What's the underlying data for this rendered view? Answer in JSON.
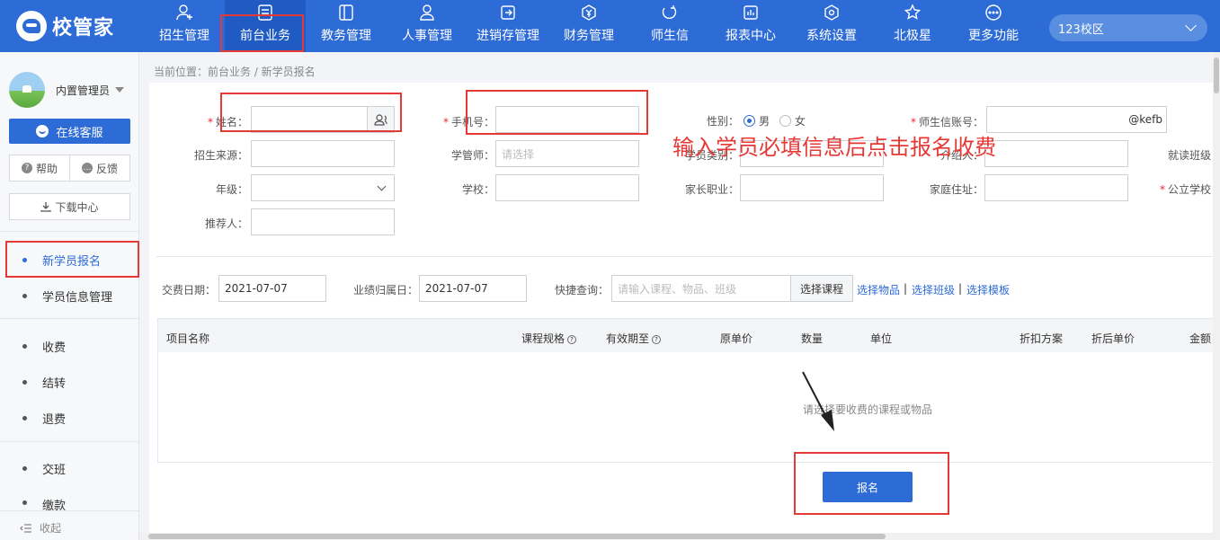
{
  "app": {
    "logo_text": "校管家"
  },
  "nav": {
    "items": [
      {
        "label": "招生管理",
        "icon": "user-plus-icon"
      },
      {
        "label": "前台业务",
        "icon": "reception-icon"
      },
      {
        "label": "教务管理",
        "icon": "book-icon"
      },
      {
        "label": "人事管理",
        "icon": "person-icon"
      },
      {
        "label": "进销存管理",
        "icon": "inventory-icon"
      },
      {
        "label": "财务管理",
        "icon": "yen-icon"
      },
      {
        "label": "师生信",
        "icon": "chat-icon"
      },
      {
        "label": "报表中心",
        "icon": "report-icon"
      },
      {
        "label": "系统设置",
        "icon": "gear-icon"
      },
      {
        "label": "北极星",
        "icon": "star-icon"
      },
      {
        "label": "更多功能",
        "icon": "more-icon"
      }
    ],
    "active_index": 1
  },
  "campus": {
    "label": "123校区"
  },
  "sidebar": {
    "user_name": "内置管理员",
    "service_label": "在线客服",
    "help_label": "帮助",
    "feedback_label": "反馈",
    "download_label": "下载中心",
    "menu": [
      "新学员报名",
      "学员信息管理",
      "收费",
      "结转",
      "退费",
      "交班",
      "缴款"
    ],
    "collapse_label": "收起"
  },
  "breadcrumb": "当前位置：前台业务 / 新学员报名",
  "form": {
    "name_label": "姓名：",
    "phone_label": "手机号：",
    "gender_label": "性别：",
    "gender_male": "男",
    "gender_female": "女",
    "account_label": "师生信账号：",
    "account_suffix": "@kefb",
    "source_label": "招生来源：",
    "advisor_label": "学管师：",
    "advisor_placeholder": "请选择",
    "type_label": "学员类别：",
    "referrer_label": "介绍人：",
    "class_label": "就读班级：",
    "grade_label": "年级：",
    "school_label": "学校：",
    "parent_job_label": "家长职业：",
    "address_label": "家庭住址：",
    "public_school_label": "公立学校：",
    "recommender_label": "推荐人："
  },
  "payment": {
    "pay_date_label": "交费日期：",
    "pay_date": "2021-07-07",
    "perf_date_label": "业绩归属日：",
    "perf_date": "2021-07-07",
    "quick_label": "快捷查询：",
    "quick_placeholder": "请输入课程、物品、班级",
    "pick_course": "选择课程",
    "link_item": "选择物品",
    "link_class": "选择班级",
    "link_template": "选择模板",
    "sep": "|"
  },
  "table": {
    "headers": [
      "项目名称",
      "课程规格",
      "有效期至",
      "原单价",
      "数量",
      "单位",
      "折扣方案",
      "折后单价",
      "金额"
    ],
    "empty_hint": "请选择要收费的课程或物品",
    "help_mark": "?"
  },
  "submit_label": "报名",
  "annotation": "输入学员必填信息后点击报名收费",
  "colors": {
    "primary": "#2d6bd6",
    "annotation": "#e53935"
  }
}
